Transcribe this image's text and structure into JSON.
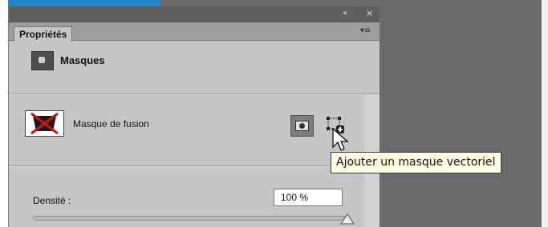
{
  "window": {
    "collapse_icon": "«",
    "close_icon": "×",
    "tab_label": "Propriétés",
    "panel_menu_icon": "▾≡"
  },
  "masks": {
    "title": "Masques"
  },
  "fusion_mask": {
    "label": "Masque de fusion"
  },
  "tooltip": {
    "text": "Ajouter un masque vectoriel"
  },
  "density": {
    "label": "Densité :",
    "value": "100 %",
    "slider_level": 1.0
  },
  "colors": {
    "workspace": "#6a6a6a",
    "panel_bg": "#c6c6c6",
    "title_bar": "#5f5f5f",
    "tooltip_bg": "#ffffe1",
    "accent_blue": "#1f86c9",
    "disabled_cross": "#c81414"
  }
}
